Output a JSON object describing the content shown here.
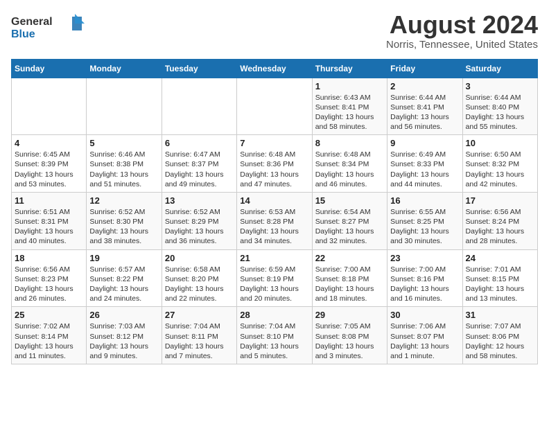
{
  "logo": {
    "general": "General",
    "blue": "Blue"
  },
  "title": {
    "month_year": "August 2024",
    "location": "Norris, Tennessee, United States"
  },
  "days_of_week": [
    "Sunday",
    "Monday",
    "Tuesday",
    "Wednesday",
    "Thursday",
    "Friday",
    "Saturday"
  ],
  "weeks": [
    [
      {
        "day": "",
        "info": ""
      },
      {
        "day": "",
        "info": ""
      },
      {
        "day": "",
        "info": ""
      },
      {
        "day": "",
        "info": ""
      },
      {
        "day": "1",
        "info": "Sunrise: 6:43 AM\nSunset: 8:41 PM\nDaylight: 13 hours\nand 58 minutes."
      },
      {
        "day": "2",
        "info": "Sunrise: 6:44 AM\nSunset: 8:41 PM\nDaylight: 13 hours\nand 56 minutes."
      },
      {
        "day": "3",
        "info": "Sunrise: 6:44 AM\nSunset: 8:40 PM\nDaylight: 13 hours\nand 55 minutes."
      }
    ],
    [
      {
        "day": "4",
        "info": "Sunrise: 6:45 AM\nSunset: 8:39 PM\nDaylight: 13 hours\nand 53 minutes."
      },
      {
        "day": "5",
        "info": "Sunrise: 6:46 AM\nSunset: 8:38 PM\nDaylight: 13 hours\nand 51 minutes."
      },
      {
        "day": "6",
        "info": "Sunrise: 6:47 AM\nSunset: 8:37 PM\nDaylight: 13 hours\nand 49 minutes."
      },
      {
        "day": "7",
        "info": "Sunrise: 6:48 AM\nSunset: 8:36 PM\nDaylight: 13 hours\nand 47 minutes."
      },
      {
        "day": "8",
        "info": "Sunrise: 6:48 AM\nSunset: 8:34 PM\nDaylight: 13 hours\nand 46 minutes."
      },
      {
        "day": "9",
        "info": "Sunrise: 6:49 AM\nSunset: 8:33 PM\nDaylight: 13 hours\nand 44 minutes."
      },
      {
        "day": "10",
        "info": "Sunrise: 6:50 AM\nSunset: 8:32 PM\nDaylight: 13 hours\nand 42 minutes."
      }
    ],
    [
      {
        "day": "11",
        "info": "Sunrise: 6:51 AM\nSunset: 8:31 PM\nDaylight: 13 hours\nand 40 minutes."
      },
      {
        "day": "12",
        "info": "Sunrise: 6:52 AM\nSunset: 8:30 PM\nDaylight: 13 hours\nand 38 minutes."
      },
      {
        "day": "13",
        "info": "Sunrise: 6:52 AM\nSunset: 8:29 PM\nDaylight: 13 hours\nand 36 minutes."
      },
      {
        "day": "14",
        "info": "Sunrise: 6:53 AM\nSunset: 8:28 PM\nDaylight: 13 hours\nand 34 minutes."
      },
      {
        "day": "15",
        "info": "Sunrise: 6:54 AM\nSunset: 8:27 PM\nDaylight: 13 hours\nand 32 minutes."
      },
      {
        "day": "16",
        "info": "Sunrise: 6:55 AM\nSunset: 8:25 PM\nDaylight: 13 hours\nand 30 minutes."
      },
      {
        "day": "17",
        "info": "Sunrise: 6:56 AM\nSunset: 8:24 PM\nDaylight: 13 hours\nand 28 minutes."
      }
    ],
    [
      {
        "day": "18",
        "info": "Sunrise: 6:56 AM\nSunset: 8:23 PM\nDaylight: 13 hours\nand 26 minutes."
      },
      {
        "day": "19",
        "info": "Sunrise: 6:57 AM\nSunset: 8:22 PM\nDaylight: 13 hours\nand 24 minutes."
      },
      {
        "day": "20",
        "info": "Sunrise: 6:58 AM\nSunset: 8:20 PM\nDaylight: 13 hours\nand 22 minutes."
      },
      {
        "day": "21",
        "info": "Sunrise: 6:59 AM\nSunset: 8:19 PM\nDaylight: 13 hours\nand 20 minutes."
      },
      {
        "day": "22",
        "info": "Sunrise: 7:00 AM\nSunset: 8:18 PM\nDaylight: 13 hours\nand 18 minutes."
      },
      {
        "day": "23",
        "info": "Sunrise: 7:00 AM\nSunset: 8:16 PM\nDaylight: 13 hours\nand 16 minutes."
      },
      {
        "day": "24",
        "info": "Sunrise: 7:01 AM\nSunset: 8:15 PM\nDaylight: 13 hours\nand 13 minutes."
      }
    ],
    [
      {
        "day": "25",
        "info": "Sunrise: 7:02 AM\nSunset: 8:14 PM\nDaylight: 13 hours\nand 11 minutes."
      },
      {
        "day": "26",
        "info": "Sunrise: 7:03 AM\nSunset: 8:12 PM\nDaylight: 13 hours\nand 9 minutes."
      },
      {
        "day": "27",
        "info": "Sunrise: 7:04 AM\nSunset: 8:11 PM\nDaylight: 13 hours\nand 7 minutes."
      },
      {
        "day": "28",
        "info": "Sunrise: 7:04 AM\nSunset: 8:10 PM\nDaylight: 13 hours\nand 5 minutes."
      },
      {
        "day": "29",
        "info": "Sunrise: 7:05 AM\nSunset: 8:08 PM\nDaylight: 13 hours\nand 3 minutes."
      },
      {
        "day": "30",
        "info": "Sunrise: 7:06 AM\nSunset: 8:07 PM\nDaylight: 13 hours\nand 1 minute."
      },
      {
        "day": "31",
        "info": "Sunrise: 7:07 AM\nSunset: 8:06 PM\nDaylight: 12 hours\nand 58 minutes."
      }
    ]
  ]
}
